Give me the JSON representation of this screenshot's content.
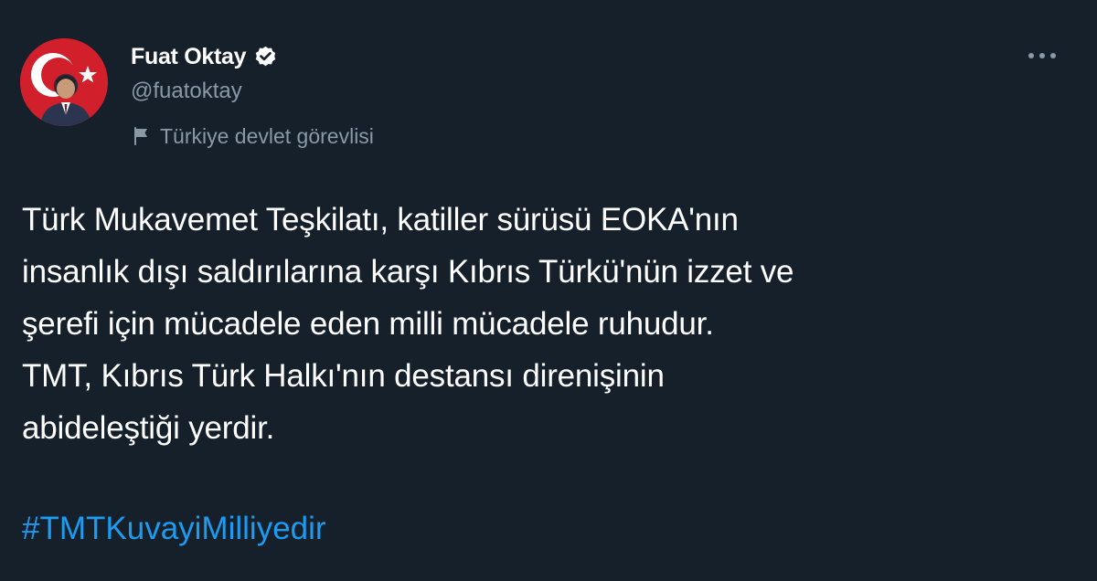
{
  "tweet": {
    "author": {
      "display_name": "Fuat Oktay",
      "handle": "@fuatoktay",
      "verified": true,
      "avatar_icon": "profile-photo-turkish-flag"
    },
    "label": {
      "icon": "flag-icon",
      "text": "Türkiye devlet görevlisi"
    },
    "more_icon": "more-options-icon",
    "body_lines": [
      "Türk Mukavemet Teşkilatı, katiller sürüsü EOKA'nın",
      "insanlık dışı saldırılarına karşı Kıbrıs Türkü'nün izzet ve",
      "şerefi için mücadele eden milli mücadele ruhudur.",
      "TMT, Kıbrıs Türk Halkı'nın destansı direnişinin",
      "abideleştiği yerdir."
    ],
    "hashtag": "#TMTKuvayiMilliyedir"
  },
  "colors": {
    "background": "#15202b",
    "text_primary": "#ffffff",
    "text_secondary": "#8b98a5",
    "link": "#1d9bf0",
    "flag_red": "#d21f2c"
  }
}
